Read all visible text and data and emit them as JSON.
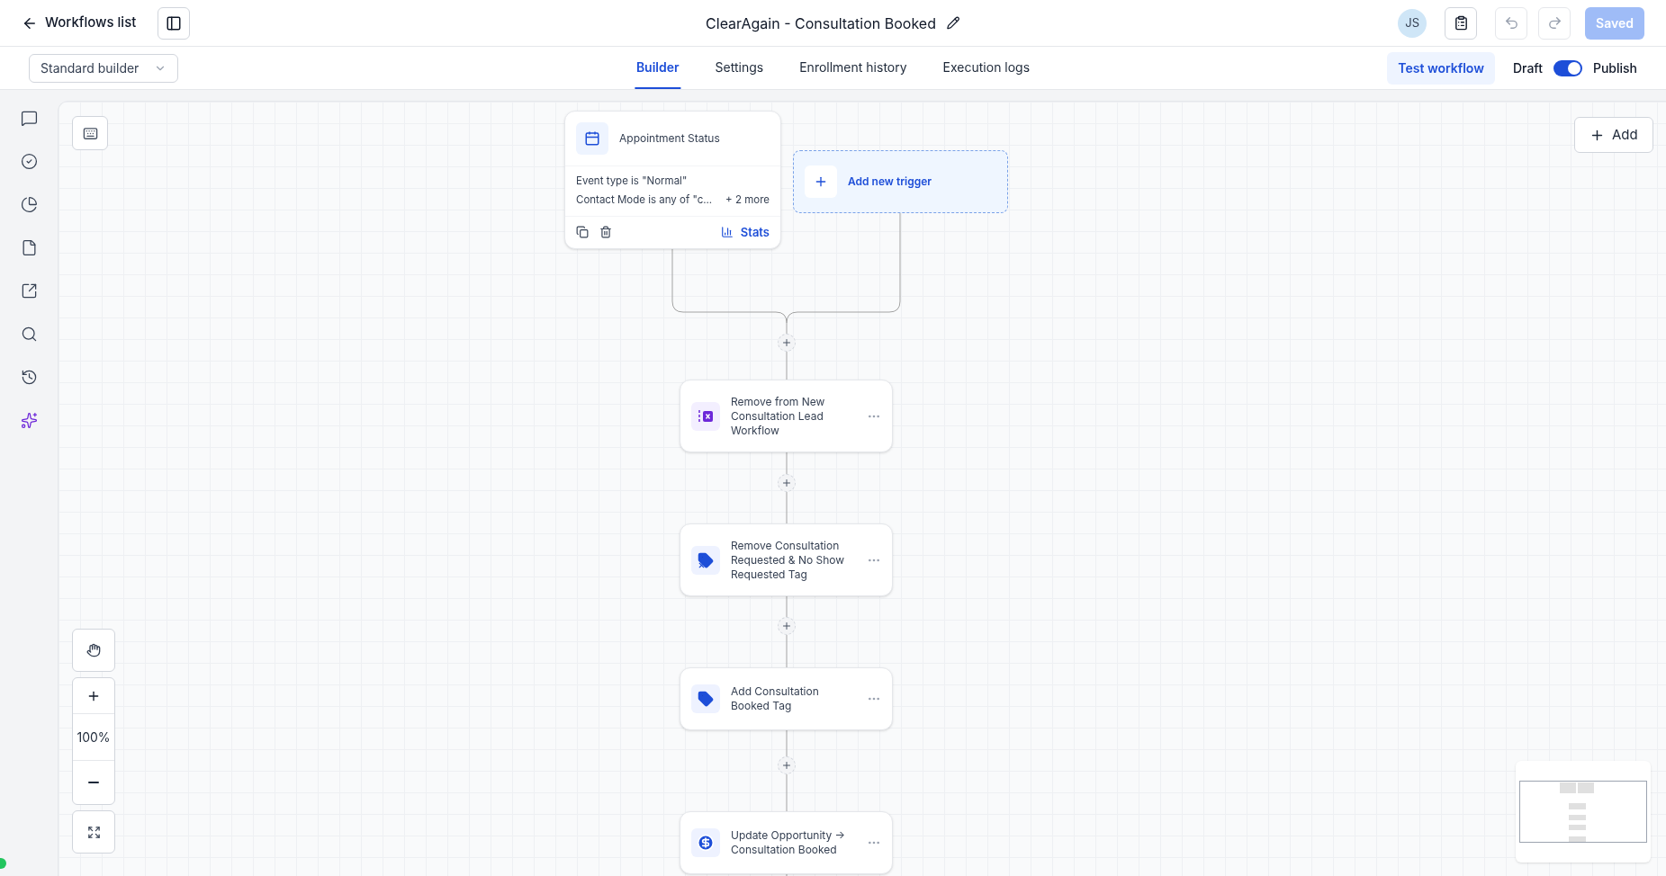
{
  "header": {
    "back_label": "Workflows list",
    "title": "ClearAgain - Consultation Booked",
    "avatar": "JS",
    "save_button": "Saved"
  },
  "toolbar": {
    "builder_select": "Standard builder",
    "tabs": [
      {
        "label": "Builder",
        "selected": true
      },
      {
        "label": "Settings",
        "selected": false
      },
      {
        "label": "Enrollment history",
        "selected": false
      },
      {
        "label": "Execution logs",
        "selected": false
      }
    ],
    "test_button": "Test workflow",
    "toggle": {
      "off_label": "Draft",
      "on_label": "Publish",
      "on": true
    }
  },
  "canvas": {
    "add_button": "Add",
    "zoom": "100%",
    "trigger": {
      "title": "Appointment Status",
      "conditions": [
        "Event type is \"Normal\"",
        "Contact Mode is any of \"c..."
      ],
      "more": "+ 2 more",
      "stats": "Stats"
    },
    "add_trigger": "Add new trigger",
    "actions": [
      {
        "title": "Remove from New Consultation Lead Workflow",
        "kind": "remove-workflow"
      },
      {
        "title": "Remove Consultation Requested & No Show Requested Tag",
        "kind": "remove-tag"
      },
      {
        "title": "Add Consultation Booked Tag",
        "kind": "add-tag"
      },
      {
        "title": "Update Opportunity → Consultation Booked",
        "kind": "opportunity"
      }
    ]
  }
}
